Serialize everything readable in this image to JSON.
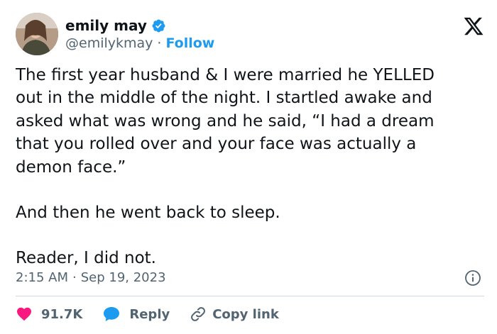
{
  "author": {
    "name": "emily may",
    "handle": "@emilykmay",
    "separator": "·",
    "follow_label": "Follow"
  },
  "tweet": {
    "paragraphs": [
      "The first year husband & I were married he YELLED\nout in the middle of the night. I startled awake and\nasked what was wrong and he said, “I had a dream\nthat you rolled over and your face was actually a\ndemon face.”",
      "And then he went back to sleep.",
      "Reader, I did not."
    ],
    "time": "2:15 AM",
    "separator": "·",
    "date": "Sep 19, 2023"
  },
  "actions": {
    "likes": "91.7K",
    "reply_label": "Reply",
    "copy_link_label": "Copy link"
  },
  "colors": {
    "accent": "#1d9bf0",
    "like": "#f91880",
    "text": "#0f1419",
    "secondary": "#536471",
    "divider": "#cfd9de"
  },
  "icons": {
    "verified": "verified-badge-icon",
    "brand": "x-logo-icon",
    "info": "info-icon",
    "like": "heart-icon",
    "reply": "speech-bubble-icon",
    "link": "link-icon"
  }
}
